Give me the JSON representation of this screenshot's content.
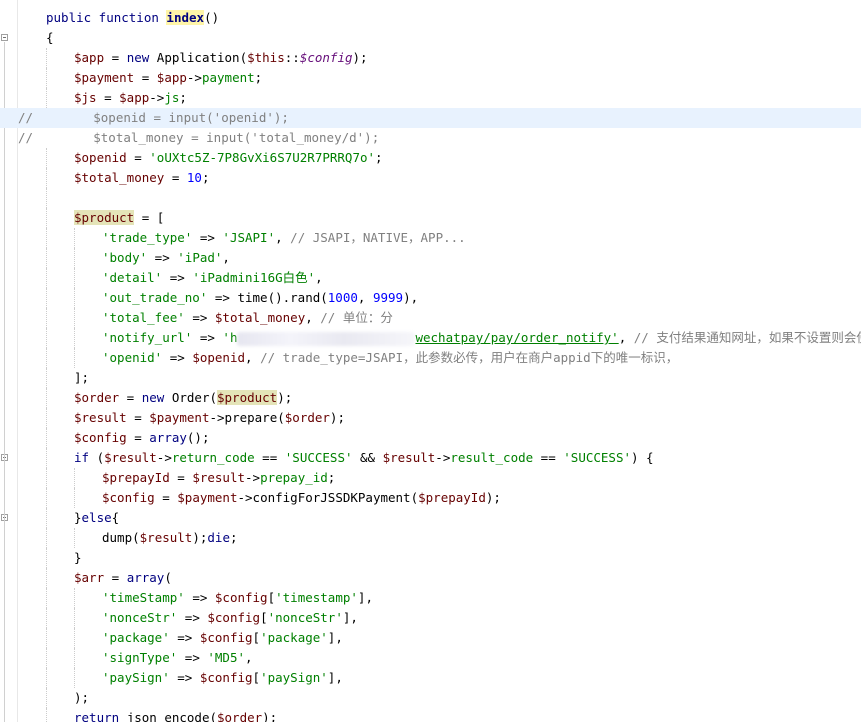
{
  "editor": {
    "lines": [
      {
        "name": "line-function-signature",
        "indent": 1,
        "tokens": [
          {
            "t": "public function ",
            "c": "kw"
          },
          {
            "t": "index",
            "c": "fn"
          },
          {
            "t": "()",
            "c": "plain"
          }
        ]
      },
      {
        "name": "line-open-brace",
        "indent": 1,
        "tokens": [
          {
            "t": "{",
            "c": "plain"
          }
        ]
      },
      {
        "name": "line-app",
        "indent": 2,
        "tokens": [
          {
            "t": "$app",
            "c": "var"
          },
          {
            "t": " = ",
            "c": "plain"
          },
          {
            "t": "new ",
            "c": "kw"
          },
          {
            "t": "Application(",
            "c": "plain"
          },
          {
            "t": "$this",
            "c": "var"
          },
          {
            "t": "::",
            "c": "plain"
          },
          {
            "t": "$config",
            "c": "const"
          },
          {
            "t": ");",
            "c": "plain"
          }
        ]
      },
      {
        "name": "line-payment",
        "indent": 2,
        "tokens": [
          {
            "t": "$payment",
            "c": "var"
          },
          {
            "t": " = ",
            "c": "plain"
          },
          {
            "t": "$app",
            "c": "var"
          },
          {
            "t": "->",
            "c": "plain"
          },
          {
            "t": "payment",
            "c": "prop"
          },
          {
            "t": ";",
            "c": "plain"
          }
        ]
      },
      {
        "name": "line-js",
        "indent": 2,
        "tokens": [
          {
            "t": "$js",
            "c": "var"
          },
          {
            "t": " = ",
            "c": "plain"
          },
          {
            "t": "$app",
            "c": "var"
          },
          {
            "t": "->",
            "c": "plain"
          },
          {
            "t": "js",
            "c": "prop"
          },
          {
            "t": ";",
            "c": "plain"
          }
        ]
      },
      {
        "name": "line-comment-openid",
        "indent": 0,
        "current": true,
        "tokens": [
          {
            "t": "//        $openid = input('openid');",
            "c": "cmt"
          }
        ]
      },
      {
        "name": "line-comment-total-money",
        "indent": 0,
        "tokens": [
          {
            "t": "//        $total_money = input('total_money/d');",
            "c": "cmt"
          }
        ]
      },
      {
        "name": "line-openid",
        "indent": 2,
        "tokens": [
          {
            "t": "$openid",
            "c": "var"
          },
          {
            "t": " = ",
            "c": "plain"
          },
          {
            "t": "'oUXtc5Z-7P8GvXi6S7U2R7PRRQ7o'",
            "c": "str"
          },
          {
            "t": ";",
            "c": "plain"
          }
        ]
      },
      {
        "name": "line-total-money",
        "indent": 2,
        "tokens": [
          {
            "t": "$total_money",
            "c": "var"
          },
          {
            "t": " = ",
            "c": "plain"
          },
          {
            "t": "10",
            "c": "num"
          },
          {
            "t": ";",
            "c": "plain"
          }
        ]
      },
      {
        "name": "line-blank-1",
        "indent": 2,
        "tokens": []
      },
      {
        "name": "line-product-open",
        "indent": 2,
        "tokens": [
          {
            "t": "$product",
            "c": "var hl"
          },
          {
            "t": " = [",
            "c": "plain"
          }
        ]
      },
      {
        "name": "line-trade-type",
        "indent": 3,
        "tokens": [
          {
            "t": "'trade_type'",
            "c": "str"
          },
          {
            "t": " => ",
            "c": "plain"
          },
          {
            "t": "'JSAPI'",
            "c": "str"
          },
          {
            "t": ", ",
            "c": "plain"
          },
          {
            "t": "// JSAPI，NATIVE，APP...",
            "c": "cmt"
          }
        ]
      },
      {
        "name": "line-body",
        "indent": 3,
        "tokens": [
          {
            "t": "'body'",
            "c": "str"
          },
          {
            "t": " => ",
            "c": "plain"
          },
          {
            "t": "'iPad'",
            "c": "str"
          },
          {
            "t": ",",
            "c": "plain"
          }
        ]
      },
      {
        "name": "line-detail",
        "indent": 3,
        "tokens": [
          {
            "t": "'detail'",
            "c": "str"
          },
          {
            "t": " => ",
            "c": "plain"
          },
          {
            "t": "'iPadmini16G白色'",
            "c": "str"
          },
          {
            "t": ",",
            "c": "plain"
          }
        ]
      },
      {
        "name": "line-out-trade-no",
        "indent": 3,
        "tokens": [
          {
            "t": "'out_trade_no'",
            "c": "str"
          },
          {
            "t": " => ",
            "c": "plain"
          },
          {
            "t": "time().rand(",
            "c": "plain"
          },
          {
            "t": "1000",
            "c": "num"
          },
          {
            "t": ", ",
            "c": "plain"
          },
          {
            "t": "9999",
            "c": "num"
          },
          {
            "t": "),",
            "c": "plain"
          }
        ]
      },
      {
        "name": "line-total-fee",
        "indent": 3,
        "tokens": [
          {
            "t": "'total_fee'",
            "c": "str"
          },
          {
            "t": " => ",
            "c": "plain"
          },
          {
            "t": "$total_money",
            "c": "var"
          },
          {
            "t": ", ",
            "c": "plain"
          },
          {
            "t": "// 单位：分",
            "c": "cmt"
          }
        ]
      },
      {
        "name": "line-notify-url",
        "indent": 3,
        "blurAfter": 2,
        "tokens": [
          {
            "t": "'notify_url'",
            "c": "str"
          },
          {
            "t": " => ",
            "c": "plain"
          },
          {
            "t": "'h",
            "c": "str"
          },
          {
            "t": "wechatpay/pay/order_notify'",
            "c": "str url"
          },
          {
            "t": ", ",
            "c": "plain"
          },
          {
            "t": "// 支付结果通知网址，如果不设置则会使用",
            "c": "cmt"
          }
        ]
      },
      {
        "name": "line-openid-field",
        "indent": 3,
        "tokens": [
          {
            "t": "'openid'",
            "c": "str"
          },
          {
            "t": " => ",
            "c": "plain"
          },
          {
            "t": "$openid",
            "c": "var"
          },
          {
            "t": ", ",
            "c": "plain"
          },
          {
            "t": "// trade_type=JSAPI，此参数必传，用户在商户appid下的唯一标识，",
            "c": "cmt"
          }
        ]
      },
      {
        "name": "line-product-close",
        "indent": 2,
        "tokens": [
          {
            "t": "];",
            "c": "plain"
          }
        ]
      },
      {
        "name": "line-order",
        "indent": 2,
        "tokens": [
          {
            "t": "$order",
            "c": "var"
          },
          {
            "t": " = ",
            "c": "plain"
          },
          {
            "t": "new ",
            "c": "kw"
          },
          {
            "t": "Order(",
            "c": "plain"
          },
          {
            "t": "$product",
            "c": "var hl"
          },
          {
            "t": ");",
            "c": "plain"
          }
        ]
      },
      {
        "name": "line-result",
        "indent": 2,
        "tokens": [
          {
            "t": "$result",
            "c": "var"
          },
          {
            "t": " = ",
            "c": "plain"
          },
          {
            "t": "$payment",
            "c": "var"
          },
          {
            "t": "->",
            "c": "plain"
          },
          {
            "t": "prepare(",
            "c": "plain"
          },
          {
            "t": "$order",
            "c": "var"
          },
          {
            "t": ");",
            "c": "plain"
          }
        ]
      },
      {
        "name": "line-config-array",
        "indent": 2,
        "tokens": [
          {
            "t": "$config",
            "c": "var"
          },
          {
            "t": " = ",
            "c": "plain"
          },
          {
            "t": "array",
            "c": "kw"
          },
          {
            "t": "();",
            "c": "plain"
          }
        ]
      },
      {
        "name": "line-if-success",
        "indent": 2,
        "tokens": [
          {
            "t": "if ",
            "c": "kw"
          },
          {
            "t": "(",
            "c": "plain"
          },
          {
            "t": "$result",
            "c": "var"
          },
          {
            "t": "->",
            "c": "plain"
          },
          {
            "t": "return_code",
            "c": "prop"
          },
          {
            "t": " == ",
            "c": "plain"
          },
          {
            "t": "'SUCCESS'",
            "c": "str"
          },
          {
            "t": " && ",
            "c": "plain"
          },
          {
            "t": "$result",
            "c": "var"
          },
          {
            "t": "->",
            "c": "plain"
          },
          {
            "t": "result_code",
            "c": "prop"
          },
          {
            "t": " == ",
            "c": "plain"
          },
          {
            "t": "'SUCCESS'",
            "c": "str"
          },
          {
            "t": ") {",
            "c": "plain"
          }
        ]
      },
      {
        "name": "line-prepay-id",
        "indent": 3,
        "tokens": [
          {
            "t": "$prepayId",
            "c": "var"
          },
          {
            "t": " = ",
            "c": "plain"
          },
          {
            "t": "$result",
            "c": "var"
          },
          {
            "t": "->",
            "c": "plain"
          },
          {
            "t": "prepay_id",
            "c": "prop"
          },
          {
            "t": ";",
            "c": "plain"
          }
        ]
      },
      {
        "name": "line-config-jssdk",
        "indent": 3,
        "tokens": [
          {
            "t": "$config",
            "c": "var"
          },
          {
            "t": " = ",
            "c": "plain"
          },
          {
            "t": "$payment",
            "c": "var"
          },
          {
            "t": "->",
            "c": "plain"
          },
          {
            "t": "configForJSSDKPayment(",
            "c": "plain"
          },
          {
            "t": "$prepayId",
            "c": "var"
          },
          {
            "t": ");",
            "c": "plain"
          }
        ]
      },
      {
        "name": "line-else",
        "indent": 2,
        "tokens": [
          {
            "t": "}",
            "c": "plain"
          },
          {
            "t": "else",
            "c": "kw"
          },
          {
            "t": "{",
            "c": "plain"
          }
        ]
      },
      {
        "name": "line-dump-die",
        "indent": 3,
        "tokens": [
          {
            "t": "dump(",
            "c": "plain"
          },
          {
            "t": "$result",
            "c": "var"
          },
          {
            "t": ");",
            "c": "plain"
          },
          {
            "t": "die",
            "c": "kw"
          },
          {
            "t": ";",
            "c": "plain"
          }
        ]
      },
      {
        "name": "line-close-if",
        "indent": 2,
        "tokens": [
          {
            "t": "}",
            "c": "plain"
          }
        ]
      },
      {
        "name": "line-arr-open",
        "indent": 2,
        "tokens": [
          {
            "t": "$arr",
            "c": "var"
          },
          {
            "t": " = ",
            "c": "plain"
          },
          {
            "t": "array",
            "c": "kw"
          },
          {
            "t": "(",
            "c": "plain"
          }
        ]
      },
      {
        "name": "line-timestamp",
        "indent": 3,
        "tokens": [
          {
            "t": "'timeStamp'",
            "c": "str"
          },
          {
            "t": " => ",
            "c": "plain"
          },
          {
            "t": "$config",
            "c": "var"
          },
          {
            "t": "[",
            "c": "plain"
          },
          {
            "t": "'timestamp'",
            "c": "str"
          },
          {
            "t": "],",
            "c": "plain"
          }
        ]
      },
      {
        "name": "line-noncestr",
        "indent": 3,
        "tokens": [
          {
            "t": "'nonceStr'",
            "c": "str"
          },
          {
            "t": " => ",
            "c": "plain"
          },
          {
            "t": "$config",
            "c": "var"
          },
          {
            "t": "[",
            "c": "plain"
          },
          {
            "t": "'nonceStr'",
            "c": "str"
          },
          {
            "t": "],",
            "c": "plain"
          }
        ]
      },
      {
        "name": "line-package",
        "indent": 3,
        "tokens": [
          {
            "t": "'package'",
            "c": "str"
          },
          {
            "t": " => ",
            "c": "plain"
          },
          {
            "t": "$config",
            "c": "var"
          },
          {
            "t": "[",
            "c": "plain"
          },
          {
            "t": "'package'",
            "c": "str"
          },
          {
            "t": "],",
            "c": "plain"
          }
        ]
      },
      {
        "name": "line-signtype",
        "indent": 3,
        "tokens": [
          {
            "t": "'signType'",
            "c": "str"
          },
          {
            "t": " => ",
            "c": "plain"
          },
          {
            "t": "'MD5'",
            "c": "str"
          },
          {
            "t": ",",
            "c": "plain"
          }
        ]
      },
      {
        "name": "line-paysign",
        "indent": 3,
        "tokens": [
          {
            "t": "'paySign'",
            "c": "str"
          },
          {
            "t": " => ",
            "c": "plain"
          },
          {
            "t": "$config",
            "c": "var"
          },
          {
            "t": "[",
            "c": "plain"
          },
          {
            "t": "'paySign'",
            "c": "str"
          },
          {
            "t": "],",
            "c": "plain"
          }
        ]
      },
      {
        "name": "line-arr-close",
        "indent": 2,
        "tokens": [
          {
            "t": ");",
            "c": "plain"
          }
        ]
      },
      {
        "name": "line-return",
        "indent": 2,
        "tokens": [
          {
            "t": "return ",
            "c": "kw"
          },
          {
            "t": "json_encode(",
            "c": "plain"
          },
          {
            "t": "$order",
            "c": "var"
          },
          {
            "t": ");",
            "c": "plain"
          }
        ]
      }
    ]
  }
}
